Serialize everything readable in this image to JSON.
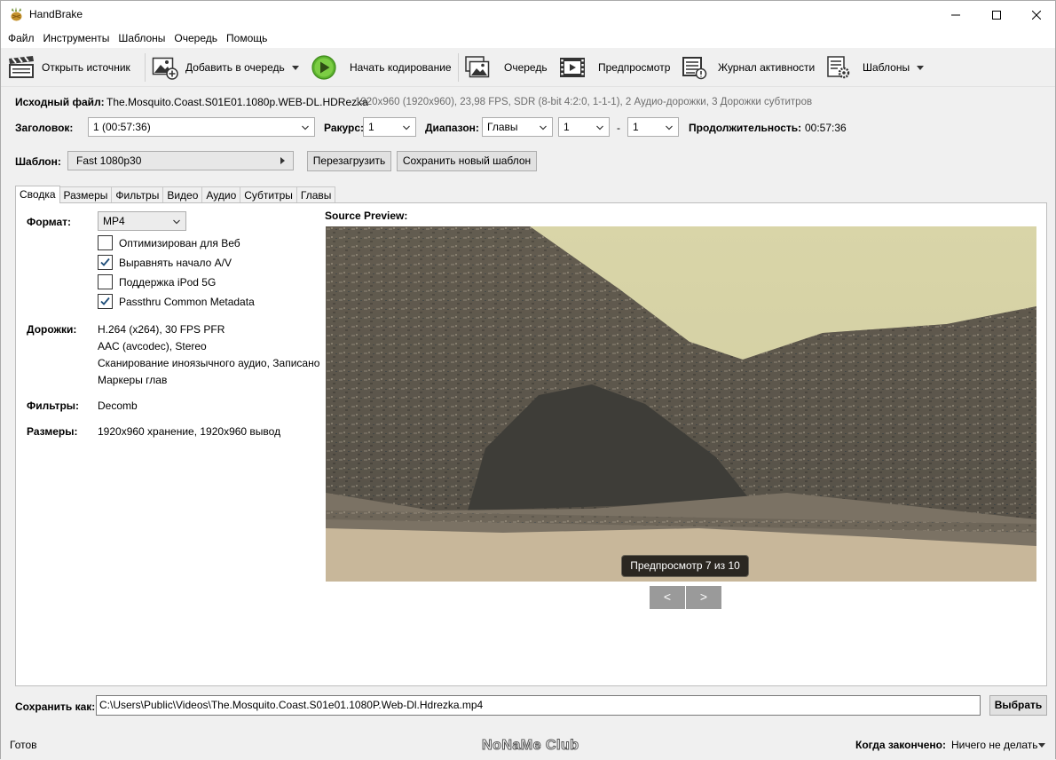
{
  "window": {
    "title": "HandBrake"
  },
  "menu": [
    "Файл",
    "Инструменты",
    "Шаблоны",
    "Очередь",
    "Помощь"
  ],
  "toolbar": {
    "open_source": "Открыть источник",
    "add_to_queue": "Добавить в очередь",
    "start_encode": "Начать кодирование",
    "queue": "Очередь",
    "preview": "Предпросмотр",
    "activity_log": "Журнал активности",
    "presets": "Шаблоны"
  },
  "source": {
    "label": "Исходный файл:",
    "name": "The.Mosquito.Coast.S01E01.1080p.WEB-DL.HDRezka",
    "details": "1920x960 (1920x960), 23,98 FPS, SDR (8-bit 4:2:0, 1-1-1), 2 Аудио-дорожки, 3 Дорожки субтитров"
  },
  "title_row": {
    "title_label": "Заголовок:",
    "title_value": "1  (00:57:36)",
    "angle_label": "Ракурс:",
    "angle_value": "1",
    "range_label": "Диапазон:",
    "range_type": "Главы",
    "range_from": "1",
    "range_dash": "-",
    "range_to": "1",
    "duration_label": "Продолжительность:",
    "duration_value": "00:57:36"
  },
  "preset": {
    "label": "Шаблон:",
    "value": "Fast 1080p30",
    "reload": "Перезагрузить",
    "save_new": "Сохранить новый шаблон"
  },
  "tabs": [
    "Сводка",
    "Размеры",
    "Фильтры",
    "Видео",
    "Аудио",
    "Субтитры",
    "Главы"
  ],
  "summary": {
    "format_label": "Формат:",
    "format_value": "MP4",
    "checkboxes": [
      {
        "label": "Оптимизирован для Веб",
        "checked": false
      },
      {
        "label": "Выравнять начало A/V",
        "checked": true
      },
      {
        "label": "Поддержка iPod 5G",
        "checked": false
      },
      {
        "label": "Passthru Common Metadata",
        "checked": true
      }
    ],
    "tracks_label": "Дорожки:",
    "tracks": [
      "H.264 (x264), 30 FPS PFR",
      "AAC (avcodec), Stereo",
      "Сканирование иноязычного аудио, Записано",
      "Маркеры глав"
    ],
    "filters_label": "Фильтры:",
    "filters_value": "Decomb",
    "size_label": "Размеры:",
    "size_value": "1920x960 хранение, 1920x960 вывод"
  },
  "preview": {
    "heading": "Source Preview:",
    "badge": "Предпросмотр 7 из 10",
    "prev": "<",
    "next": ">"
  },
  "save": {
    "label": "Сохранить как:",
    "path": "C:\\Users\\Public\\Videos\\The.Mosquito.Coast.S01e01.1080P.Web-Dl.Hdrezka.mp4",
    "browse": "Выбрать"
  },
  "status": {
    "text": "Готов",
    "watermark": "NoNaMe Club",
    "when_done_label": "Когда закончено:",
    "when_done_value": "Ничего не делать"
  }
}
